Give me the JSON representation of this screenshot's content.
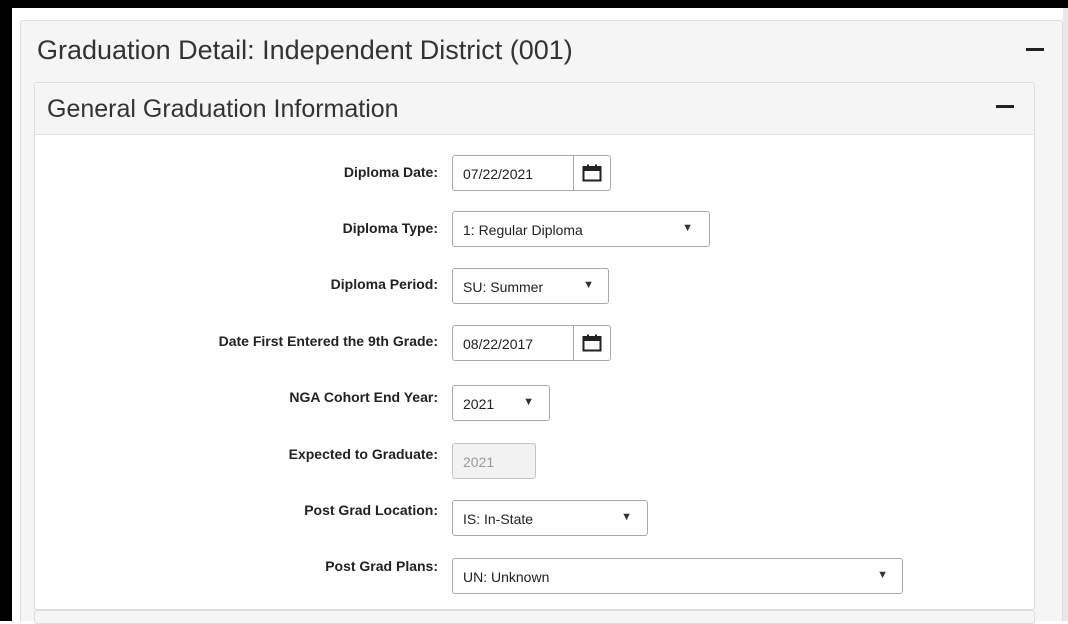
{
  "outer_panel": {
    "title": "Graduation Detail: Independent District (001)"
  },
  "inner_panel": {
    "title": "General Graduation Information"
  },
  "form": {
    "diploma_date": {
      "label": "Diploma Date:",
      "value": "07/22/2021"
    },
    "diploma_type": {
      "label": "Diploma Type:",
      "value": "1: Regular Diploma"
    },
    "diploma_period": {
      "label": "Diploma Period:",
      "value": "SU: Summer"
    },
    "first_entered_9th": {
      "label": "Date First Entered the 9th Grade:",
      "value": "08/22/2017"
    },
    "nga_cohort_end_year": {
      "label": "NGA Cohort End Year:",
      "value": "2021"
    },
    "expected_to_graduate": {
      "label": "Expected to Graduate:",
      "value": "2021"
    },
    "post_grad_location": {
      "label": "Post Grad Location:",
      "value": "IS: In-State"
    },
    "post_grad_plans": {
      "label": "Post Grad Plans:",
      "value": "UN: Unknown"
    }
  },
  "icons": {
    "calendar": "calendar-icon",
    "dropdown": "caret-down-icon",
    "collapse": "minus-icon"
  },
  "colors": {
    "panel_bg": "#f5f5f5",
    "border": "#dcdcdc",
    "input_border": "#a9a9a9"
  }
}
